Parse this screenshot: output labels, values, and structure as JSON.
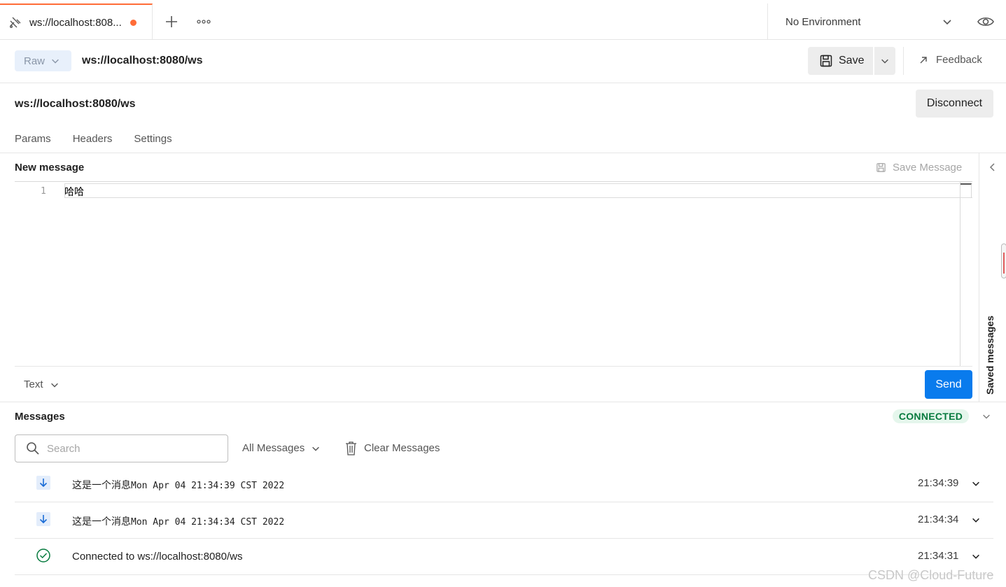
{
  "tab": {
    "title": "ws://localhost:808...",
    "icon": "websocket-icon",
    "unsaved_dot_color": "#ff6c37"
  },
  "environment": {
    "label": "No Environment"
  },
  "request": {
    "mode": "Raw",
    "title": "ws://localhost:8080/ws",
    "save_label": "Save",
    "feedback_label": "Feedback",
    "connection_url": "ws://localhost:8080/ws",
    "disconnect_label": "Disconnect"
  },
  "subtabs": [
    "Params",
    "Headers",
    "Settings"
  ],
  "composer": {
    "title": "New message",
    "save_message_label": "Save Message",
    "line_number": "1",
    "content": "哈哈",
    "format": "Text",
    "send_label": "Send"
  },
  "side_panel": {
    "label": "Saved messages"
  },
  "messages": {
    "title": "Messages",
    "status": "CONNECTED",
    "search_placeholder": "Search",
    "filter_label": "All Messages",
    "clear_label": "Clear Messages",
    "items": [
      {
        "type": "incoming",
        "text_cn": "这是一个消息",
        "text_rest": "Mon Apr 04 21:34:39 CST 2022",
        "time": "21:34:39"
      },
      {
        "type": "incoming",
        "text_cn": "这是一个消息",
        "text_rest": "Mon Apr 04 21:34:34 CST 2022",
        "time": "21:34:34"
      },
      {
        "type": "connected",
        "text": "Connected to ws://localhost:8080/ws",
        "time": "21:34:31"
      }
    ]
  },
  "watermark": "CSDN @Cloud-Future",
  "colors": {
    "accent_orange": "#ff6c37",
    "send_blue": "#097bed",
    "connected_green": "#067a3e",
    "incoming_arrow_blue": "#1a6cd6"
  }
}
